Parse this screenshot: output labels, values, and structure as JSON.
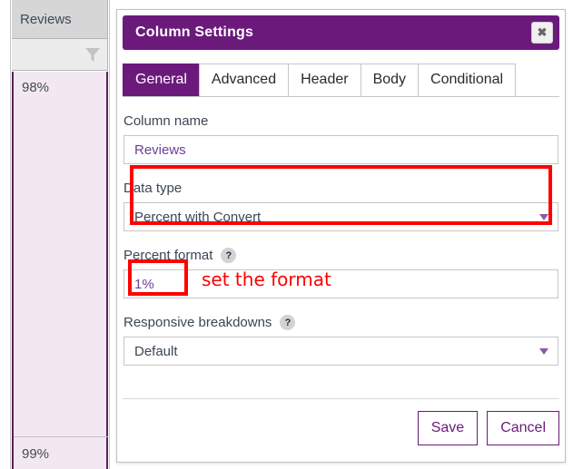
{
  "background_grid": {
    "column_header": "Reviews",
    "filter_icon": "funnel-icon",
    "cells": [
      {
        "value": "98%"
      },
      {
        "value": "99%"
      }
    ]
  },
  "dialog": {
    "title": "Column Settings",
    "close_icon": "✖",
    "tabs": [
      {
        "label": "General",
        "active": true
      },
      {
        "label": "Advanced",
        "active": false
      },
      {
        "label": "Header",
        "active": false
      },
      {
        "label": "Body",
        "active": false
      },
      {
        "label": "Conditional",
        "active": false
      }
    ],
    "fields": {
      "column_name": {
        "label": "Column name",
        "value": "Reviews",
        "placeholder": "Column name"
      },
      "data_type": {
        "label": "Data type",
        "value": "Percent with Convert",
        "caret_icon": "chevron-down-icon"
      },
      "percent_format": {
        "label": "Percent format",
        "help_icon": "?",
        "value": "1%",
        "placeholder": "1%"
      },
      "responsive_breakdowns": {
        "label": "Responsive breakdowns",
        "help_icon": "?",
        "value": "Default",
        "caret_icon": "chevron-down-icon"
      }
    },
    "footer": {
      "save_label": "Save",
      "cancel_label": "Cancel"
    }
  },
  "annotations": {
    "note_text": "set the format",
    "color": "#fe0000"
  },
  "colors": {
    "brand_purple": "#6b1a7b",
    "input_text_purple": "#6b3f96",
    "cell_background": "#f2e8f2",
    "annotation_red": "#fe0000"
  }
}
